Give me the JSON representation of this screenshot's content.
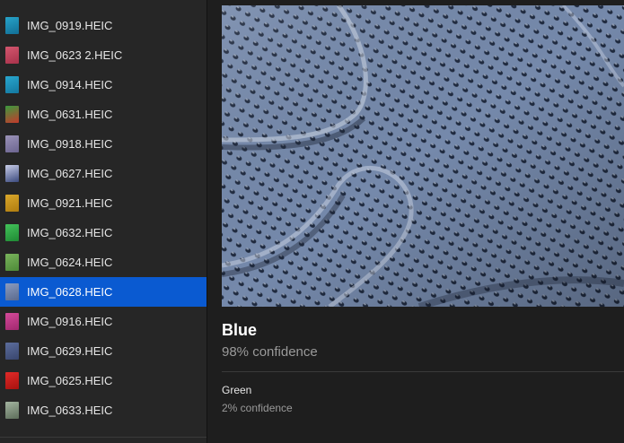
{
  "sidebar": {
    "files": [
      {
        "name": "IMG_0919.HEIC",
        "thumb_color": "#27a3c9",
        "thumb_color2": "#126f96",
        "selected": false
      },
      {
        "name": "IMG_0623 2.HEIC",
        "thumb_color": "#d3566e",
        "thumb_color2": "#a8324b",
        "selected": false
      },
      {
        "name": "IMG_0914.HEIC",
        "thumb_color": "#29a7cf",
        "thumb_color2": "#1478a0",
        "selected": false
      },
      {
        "name": "IMG_0631.HEIC",
        "thumb_color": "#3b9a3e",
        "thumb_color2": "#c43a2c",
        "selected": false
      },
      {
        "name": "IMG_0918.HEIC",
        "thumb_color": "#9b93b8",
        "thumb_color2": "#6c6590",
        "selected": false
      },
      {
        "name": "IMG_0627.HEIC",
        "thumb_color": "#c8cde8",
        "thumb_color2": "#3b4a7d",
        "selected": false
      },
      {
        "name": "IMG_0921.HEIC",
        "thumb_color": "#d9a72b",
        "thumb_color2": "#b07d10",
        "selected": false
      },
      {
        "name": "IMG_0632.HEIC",
        "thumb_color": "#43c25a",
        "thumb_color2": "#1f8a34",
        "selected": false
      },
      {
        "name": "IMG_0624.HEIC",
        "thumb_color": "#79b35c",
        "thumb_color2": "#4e8a38",
        "selected": false
      },
      {
        "name": "IMG_0628.HEIC",
        "thumb_color": "#8a9bbf",
        "thumb_color2": "#5a6a8e",
        "selected": true
      },
      {
        "name": "IMG_0916.HEIC",
        "thumb_color": "#d44a9a",
        "thumb_color2": "#a2286f",
        "selected": false
      },
      {
        "name": "IMG_0629.HEIC",
        "thumb_color": "#5c6d9c",
        "thumb_color2": "#39466e",
        "selected": false
      },
      {
        "name": "IMG_0625.HEIC",
        "thumb_color": "#e02a28",
        "thumb_color2": "#a8120f",
        "selected": false
      },
      {
        "name": "IMG_0633.HEIC",
        "thumb_color": "#a3b4a0",
        "thumb_color2": "#5e6e5b",
        "selected": false
      }
    ]
  },
  "detail": {
    "primary": {
      "label": "Blue",
      "confidence": "98% confidence"
    },
    "secondary": {
      "label": "Green",
      "confidence": "2% confidence"
    }
  },
  "colors": {
    "selection": "#0a5ad1",
    "fabric": "#6f82a4"
  }
}
